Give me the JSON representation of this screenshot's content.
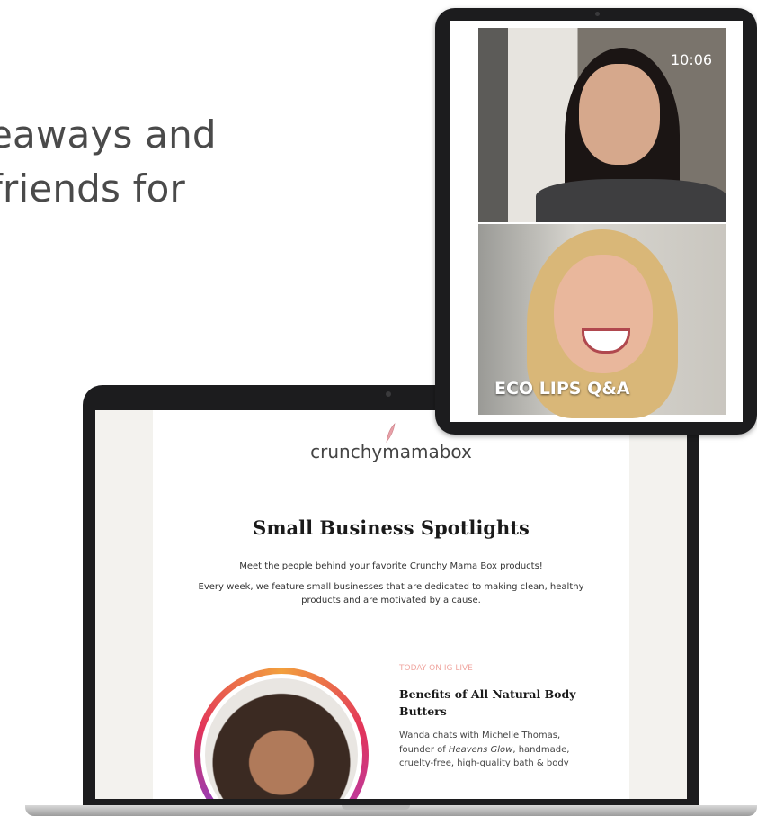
{
  "hero": {
    "line1": "eaways and",
    "line2": "friends for"
  },
  "newsletter": {
    "brand": "crunchymamabox",
    "title": "Small Business Spotlights",
    "intro_1": "Meet the people behind your favorite Crunchy Mama Box products!",
    "intro_2": "Every week, we feature small businesses that are dedicated to making clean, healthy products and are motivated by a cause.",
    "event": {
      "label": "TODAY ON IG LIVE",
      "title": "Benefits of All Natural Body Butters",
      "desc_prefix": "Wanda chats with Michelle Thomas, founder of ",
      "desc_brand": "Heavens Glow",
      "desc_suffix": ", handmade, cruelty-free, high-quality bath & body"
    }
  },
  "tablet": {
    "clock": "10:06",
    "caption": "ECO LIPS Q&A"
  },
  "colors": {
    "event_label": "#f0a7a1",
    "device_frame": "#1c1c1e",
    "ring_start": "#f2a03d",
    "ring_mid": "#e2345a",
    "ring_end": "#7b3fd6"
  },
  "icons": {
    "logo": "feather-icon"
  }
}
